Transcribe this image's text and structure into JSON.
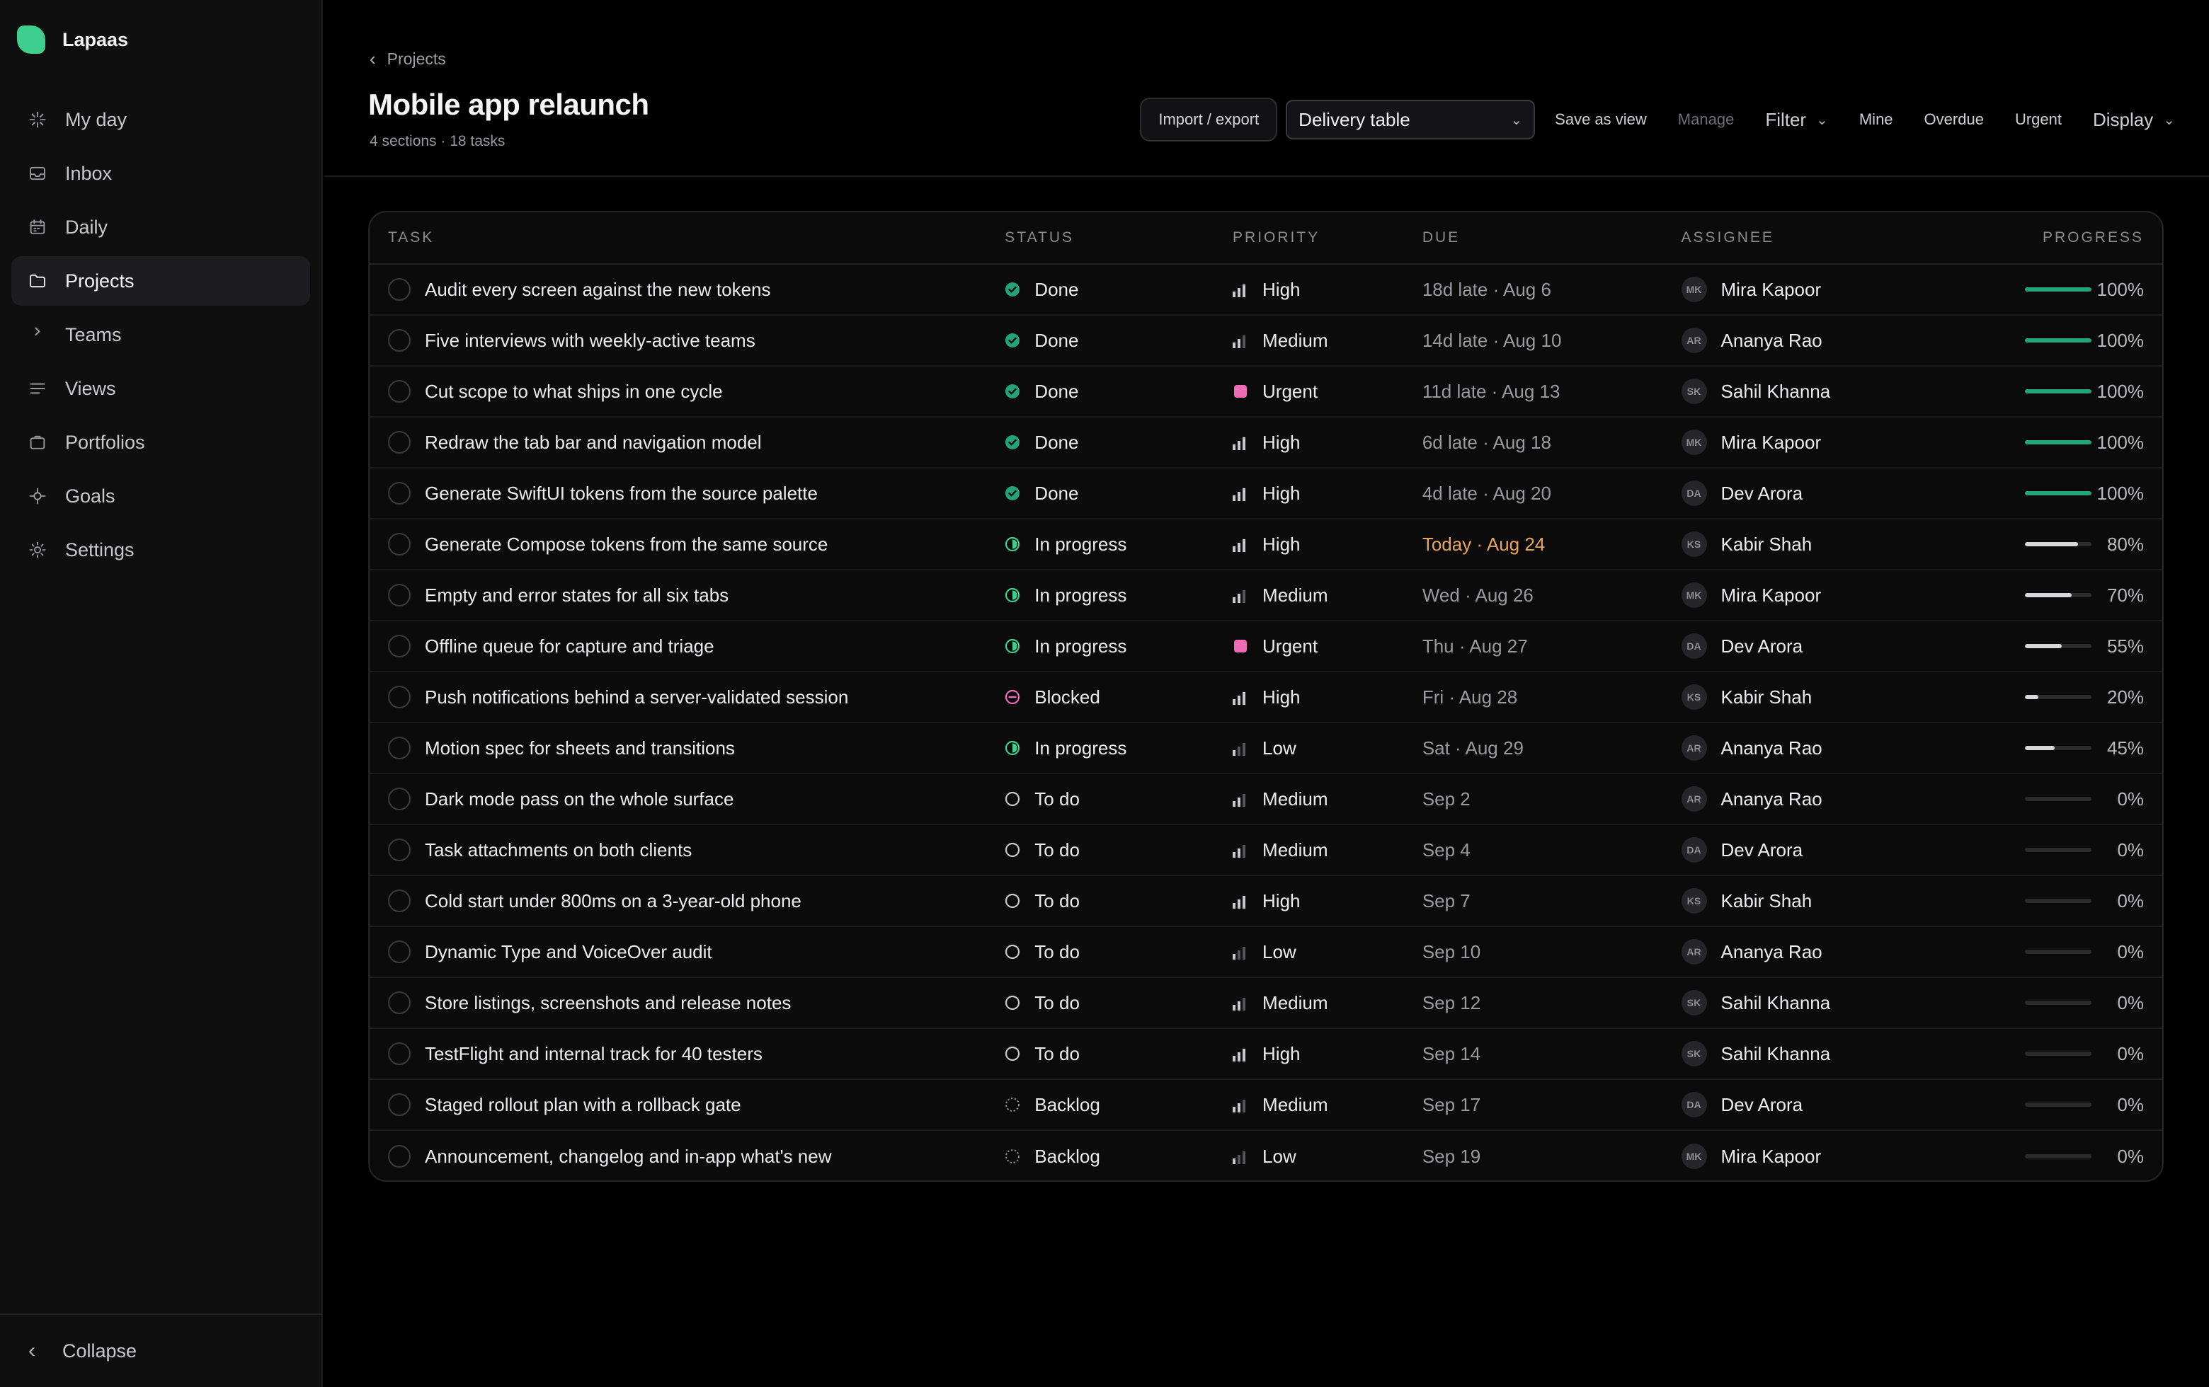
{
  "app": {
    "name": "Lapaas"
  },
  "sidebar": {
    "items": [
      {
        "label": "My day",
        "icon": "sparkle-icon",
        "active": false
      },
      {
        "label": "Inbox",
        "icon": "inbox-icon",
        "active": false
      },
      {
        "label": "Daily",
        "icon": "calendar-icon",
        "active": false
      },
      {
        "label": "Projects",
        "icon": "folder-icon",
        "active": true
      },
      {
        "label": "Teams",
        "icon": "chevron-right-icon",
        "active": false
      },
      {
        "label": "Views",
        "icon": "list-icon",
        "active": false
      },
      {
        "label": "Portfolios",
        "icon": "briefcase-icon",
        "active": false
      },
      {
        "label": "Goals",
        "icon": "target-icon",
        "active": false
      },
      {
        "label": "Settings",
        "icon": "gear-icon",
        "active": false
      }
    ],
    "collapse_label": "Collapse"
  },
  "header": {
    "breadcrumb": "Projects",
    "title": "Mobile app relaunch",
    "subtitle": "4 sections · 18 tasks"
  },
  "toolbar": {
    "import_export": "Import / export",
    "view_select": "Delivery table",
    "save_as_view": "Save as view",
    "manage": "Manage",
    "filter": "Filter",
    "mine": "Mine",
    "overdue": "Overdue",
    "urgent": "Urgent",
    "display": "Display"
  },
  "table": {
    "headers": {
      "task": "Task",
      "status": "Status",
      "priority": "Priority",
      "due": "Due",
      "assignee": "Assignee",
      "progress": "Progress"
    },
    "rows": [
      {
        "task": "Audit every screen against the new tokens",
        "status": "Done",
        "priority": "High",
        "due": "18d late · Aug 6",
        "due_today": false,
        "initials": "MK",
        "assignee": "Mira Kapoor",
        "progress": 100
      },
      {
        "task": "Five interviews with weekly-active teams",
        "status": "Done",
        "priority": "Medium",
        "due": "14d late · Aug 10",
        "due_today": false,
        "initials": "AR",
        "assignee": "Ananya Rao",
        "progress": 100
      },
      {
        "task": "Cut scope to what ships in one cycle",
        "status": "Done",
        "priority": "Urgent",
        "due": "11d late · Aug 13",
        "due_today": false,
        "initials": "SK",
        "assignee": "Sahil Khanna",
        "progress": 100
      },
      {
        "task": "Redraw the tab bar and navigation model",
        "status": "Done",
        "priority": "High",
        "due": "6d late · Aug 18",
        "due_today": false,
        "initials": "MK",
        "assignee": "Mira Kapoor",
        "progress": 100
      },
      {
        "task": "Generate SwiftUI tokens from the source palette",
        "status": "Done",
        "priority": "High",
        "due": "4d late · Aug 20",
        "due_today": false,
        "initials": "DA",
        "assignee": "Dev Arora",
        "progress": 100
      },
      {
        "task": "Generate Compose tokens from the same source",
        "status": "In progress",
        "priority": "High",
        "due": "Today · Aug 24",
        "due_today": true,
        "initials": "KS",
        "assignee": "Kabir Shah",
        "progress": 80
      },
      {
        "task": "Empty and error states for all six tabs",
        "status": "In progress",
        "priority": "Medium",
        "due": "Wed · Aug 26",
        "due_today": false,
        "initials": "MK",
        "assignee": "Mira Kapoor",
        "progress": 70
      },
      {
        "task": "Offline queue for capture and triage",
        "status": "In progress",
        "priority": "Urgent",
        "due": "Thu · Aug 27",
        "due_today": false,
        "initials": "DA",
        "assignee": "Dev Arora",
        "progress": 55
      },
      {
        "task": "Push notifications behind a server-validated session",
        "status": "Blocked",
        "priority": "High",
        "due": "Fri · Aug 28",
        "due_today": false,
        "initials": "KS",
        "assignee": "Kabir Shah",
        "progress": 20
      },
      {
        "task": "Motion spec for sheets and transitions",
        "status": "In progress",
        "priority": "Low",
        "due": "Sat · Aug 29",
        "due_today": false,
        "initials": "AR",
        "assignee": "Ananya Rao",
        "progress": 45
      },
      {
        "task": "Dark mode pass on the whole surface",
        "status": "To do",
        "priority": "Medium",
        "due": "Sep 2",
        "due_today": false,
        "initials": "AR",
        "assignee": "Ananya Rao",
        "progress": 0
      },
      {
        "task": "Task attachments on both clients",
        "status": "To do",
        "priority": "Medium",
        "due": "Sep 4",
        "due_today": false,
        "initials": "DA",
        "assignee": "Dev Arora",
        "progress": 0
      },
      {
        "task": "Cold start under 800ms on a 3-year-old phone",
        "status": "To do",
        "priority": "High",
        "due": "Sep 7",
        "due_today": false,
        "initials": "KS",
        "assignee": "Kabir Shah",
        "progress": 0
      },
      {
        "task": "Dynamic Type and VoiceOver audit",
        "status": "To do",
        "priority": "Low",
        "due": "Sep 10",
        "due_today": false,
        "initials": "AR",
        "assignee": "Ananya Rao",
        "progress": 0
      },
      {
        "task": "Store listings, screenshots and release notes",
        "status": "To do",
        "priority": "Medium",
        "due": "Sep 12",
        "due_today": false,
        "initials": "SK",
        "assignee": "Sahil Khanna",
        "progress": 0
      },
      {
        "task": "TestFlight and internal track for 40 testers",
        "status": "To do",
        "priority": "High",
        "due": "Sep 14",
        "due_today": false,
        "initials": "SK",
        "assignee": "Sahil Khanna",
        "progress": 0
      },
      {
        "task": "Staged rollout plan with a rollback gate",
        "status": "Backlog",
        "priority": "Medium",
        "due": "Sep 17",
        "due_today": false,
        "initials": "DA",
        "assignee": "Dev Arora",
        "progress": 0
      },
      {
        "task": "Announcement, changelog and in-app what's new",
        "status": "Backlog",
        "priority": "Low",
        "due": "Sep 19",
        "due_today": false,
        "initials": "MK",
        "assignee": "Mira Kapoor",
        "progress": 0
      }
    ]
  },
  "colors": {
    "brand": "#3ecf8e",
    "done": "#22a37a",
    "in_progress": "#3ecf8e",
    "blocked": "#f06bb5",
    "urgent": "#f06bb5",
    "today": "#e8a55a"
  }
}
